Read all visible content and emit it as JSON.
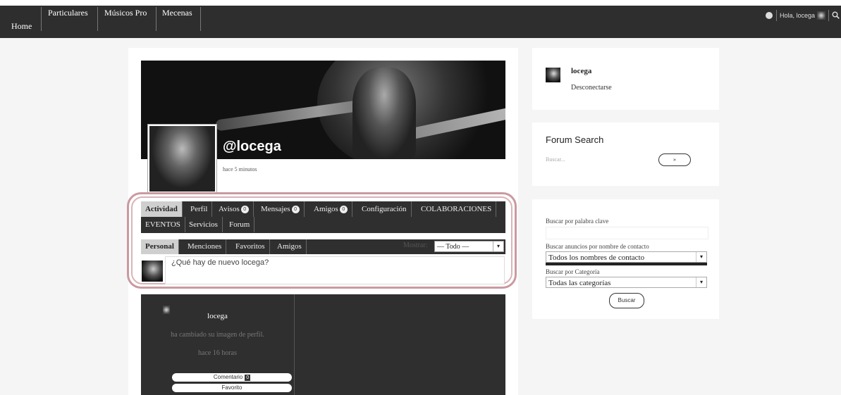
{
  "topnav": {
    "home": "Home",
    "items": [
      "Particulares",
      "Músicos Pro",
      "Mecenas"
    ],
    "greeting": "Hola, locega",
    "search_icon": "search-icon",
    "user_icon": "user-circle-icon"
  },
  "profile": {
    "username": "@locega",
    "last_active": "hace 5 minutos"
  },
  "tabs": [
    {
      "label": "Actividad"
    },
    {
      "label": "Perfil"
    },
    {
      "label": "Avisos",
      "count": "0"
    },
    {
      "label": "Mensajes",
      "count": "0"
    },
    {
      "label": "Amigos",
      "count": "0"
    },
    {
      "label": "Configuración"
    },
    {
      "label": "COLABORACIONES"
    },
    {
      "label": "EVENTOS"
    },
    {
      "label": "Servicios"
    },
    {
      "label": "Forum"
    }
  ],
  "subtabs": [
    {
      "label": "Personal"
    },
    {
      "label": "Menciones"
    },
    {
      "label": "Favoritos"
    },
    {
      "label": "Amigos"
    }
  ],
  "filter": {
    "label": "Mostrar:",
    "selected": "— Todo —"
  },
  "status": {
    "placeholder": "¿Qué hay de nuevo locega?"
  },
  "activity": {
    "user": "locega",
    "text": "ha cambiado su imagen de perfil.",
    "time": "hace 16 horas",
    "comment_label": "Comentario",
    "comment_count": "0",
    "favorite_label": "Favorito"
  },
  "sidebar": {
    "user": "locega",
    "logout": "Desconectarse",
    "forum_search_title": "Forum Search",
    "forum_search_placeholder": "Buscar...",
    "forum_search_button": "»",
    "keyword_label": "Buscar por palabra clave",
    "contact_label": "Buscar anuncios por nombre de contacto",
    "contact_selected": "Todos los nombres de contacto",
    "category_label": "Buscar por Categoría",
    "category_selected": "Todas las categorías",
    "search_button": "Buscar"
  }
}
